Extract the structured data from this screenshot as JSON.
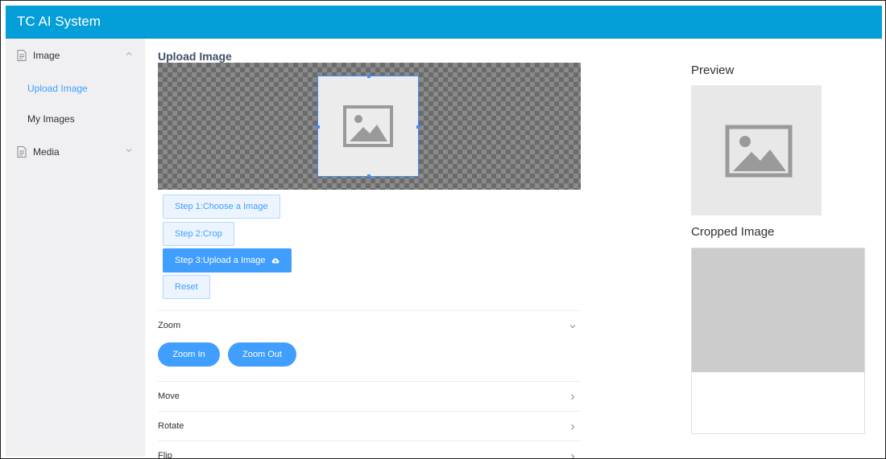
{
  "header": {
    "title": "TC AI System"
  },
  "sidebar": {
    "groups": [
      {
        "label": "Image",
        "expanded": true,
        "items": [
          {
            "label": "Upload Image",
            "active": true
          },
          {
            "label": "My Images",
            "active": false
          }
        ]
      },
      {
        "label": "Media",
        "expanded": false,
        "items": []
      }
    ]
  },
  "main": {
    "section_title": "Upload Image",
    "steps": [
      {
        "label": "Step 1:Choose a Image",
        "primary": false
      },
      {
        "label": "Step 2:Crop",
        "primary": false
      },
      {
        "label": "Step 3:Upload a Image",
        "primary": true,
        "icon": "cloud-upload-icon"
      },
      {
        "label": "Reset",
        "primary": false
      }
    ],
    "panels": [
      {
        "label": "Zoom",
        "expanded": true,
        "buttons": [
          "Zoom In",
          "Zoom Out"
        ]
      },
      {
        "label": "Move",
        "expanded": false
      },
      {
        "label": "Rotate",
        "expanded": false
      },
      {
        "label": "Flip",
        "expanded": false
      }
    ]
  },
  "preview": {
    "title": "Preview",
    "cropped_title": "Cropped Image"
  },
  "colors": {
    "header": "#049fd9",
    "accent": "#409eff",
    "sidebar_bg": "#f0f0f3"
  }
}
